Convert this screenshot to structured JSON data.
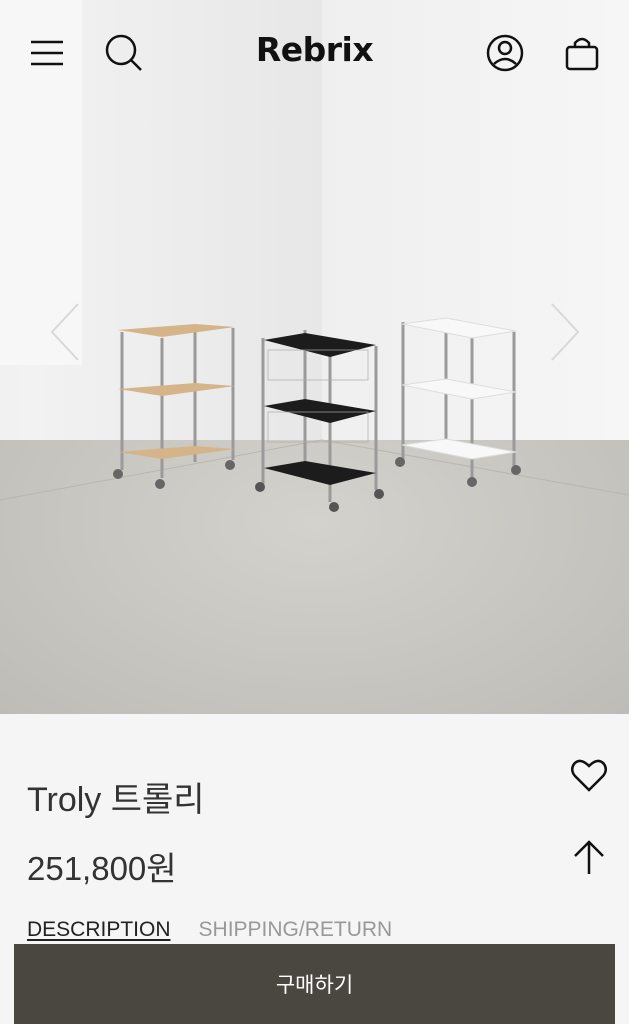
{
  "header": {
    "logo": "Rebrix",
    "menu_icon": "menu-icon",
    "search_icon": "search-icon",
    "account_icon": "account-icon",
    "cart_icon": "shopping-bag-icon"
  },
  "carousel": {
    "prev_icon": "chevron-left-icon",
    "next_icon": "chevron-right-icon",
    "image_alt": "Troly trolleys in wood, black and white"
  },
  "product": {
    "name": "Troly 트롤리",
    "price": "251,800원"
  },
  "tabs": [
    {
      "label": "DESCRIPTION",
      "active": true
    },
    {
      "label": "SHIPPING/RETURN",
      "active": false
    }
  ],
  "buy_button": {
    "label": "구매하기"
  },
  "colors": {
    "buy_bg": "#4a4740",
    "background": "#f5f5f5"
  }
}
